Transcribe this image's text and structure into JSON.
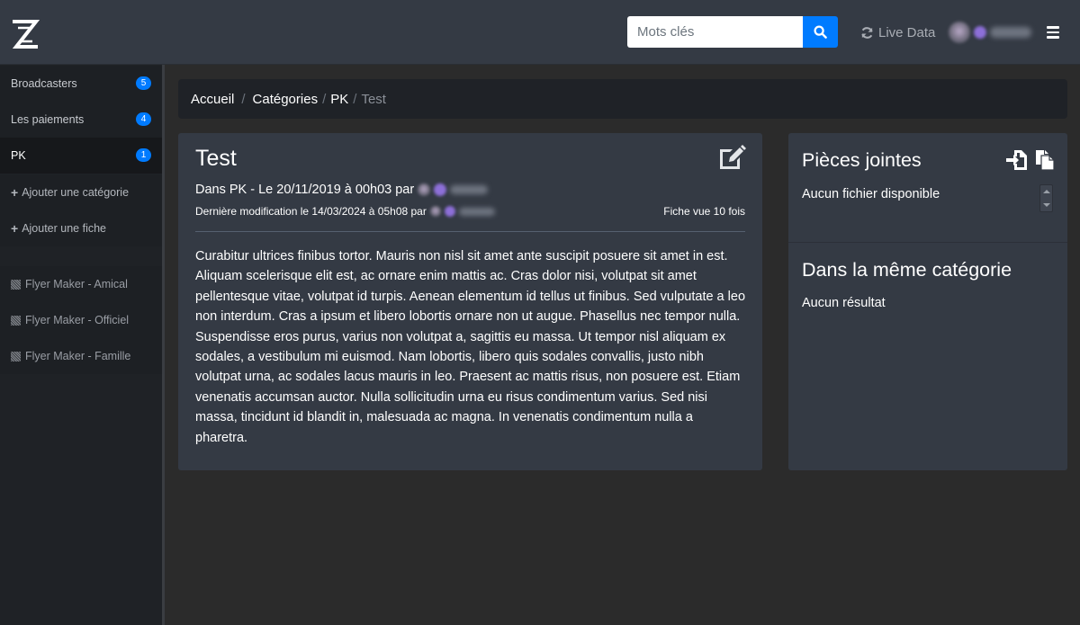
{
  "header": {
    "search": {
      "placeholder": "Mots clés",
      "value": ""
    },
    "live_data_label": "Live Data",
    "icons": {
      "logo": "zz-logo",
      "search": "search-icon",
      "refresh": "refresh-icon",
      "menu": "hamburger-icon"
    }
  },
  "sidebar": {
    "items": [
      {
        "label": "Broadcasters",
        "badge": "5"
      },
      {
        "label": "Les paiements",
        "badge": "4"
      },
      {
        "label": "PK",
        "badge": "1"
      }
    ],
    "actions": [
      {
        "label": "Ajouter une catégorie"
      },
      {
        "label": "Ajouter une fiche"
      }
    ],
    "tools": [
      {
        "label": "Flyer Maker - Amical"
      },
      {
        "label": "Flyer Maker - Officiel"
      },
      {
        "label": "Flyer Maker - Famille"
      }
    ]
  },
  "breadcrumb": {
    "home": "Accueil",
    "sep1": "/",
    "categories": "Catégories",
    "sep2": "/",
    "pk": "PK",
    "sep3": "/",
    "current": "Test"
  },
  "article": {
    "title": "Test",
    "meta_line": "Dans PK - Le 20/11/2019 à 00h03 par",
    "modified_line": "Dernière modification le 14/03/2024 à 05h08 par",
    "views": "Fiche vue 10 fois",
    "body": "Curabitur ultrices finibus tortor. Mauris non nisl sit amet ante suscipit posuere sit amet in est. Aliquam scelerisque elit est, ac ornare enim mattis ac. Cras dolor nisi, volutpat sit amet pellentesque vitae, volutpat id turpis. Aenean elementum id tellus ut finibus. Sed vulputate a leo non interdum. Cras a ipsum et libero lobortis ornare non ut augue. Phasellus nec tempor nulla. Suspendisse eros purus, varius non volutpat a, sagittis eu massa. Ut tempor nisl aliquam ex sodales, a vestibulum mi euismod. Nam lobortis, libero quis sodales convallis, justo nibh volutpat urna, ac sodales lacus mauris in leo. Praesent ac mattis risus, non posuere est. Etiam venenatis accumsan auctor. Nulla sollicitudin urna eu risus condimentum varius. Sed nisi massa, tincidunt id blandit in, malesuada ac magna. In venenatis condimentum nulla a pharetra."
  },
  "attachments": {
    "title": "Pièces jointes",
    "empty": "Aucun fichier disponible"
  },
  "same_category": {
    "title": "Dans la même catégorie",
    "empty": "Aucun résultat"
  },
  "colors": {
    "topbar": "#343a44",
    "sidebar": "#1f2226",
    "card": "#343a44",
    "accent": "#007bff",
    "page_bg": "#2b2b2b"
  }
}
